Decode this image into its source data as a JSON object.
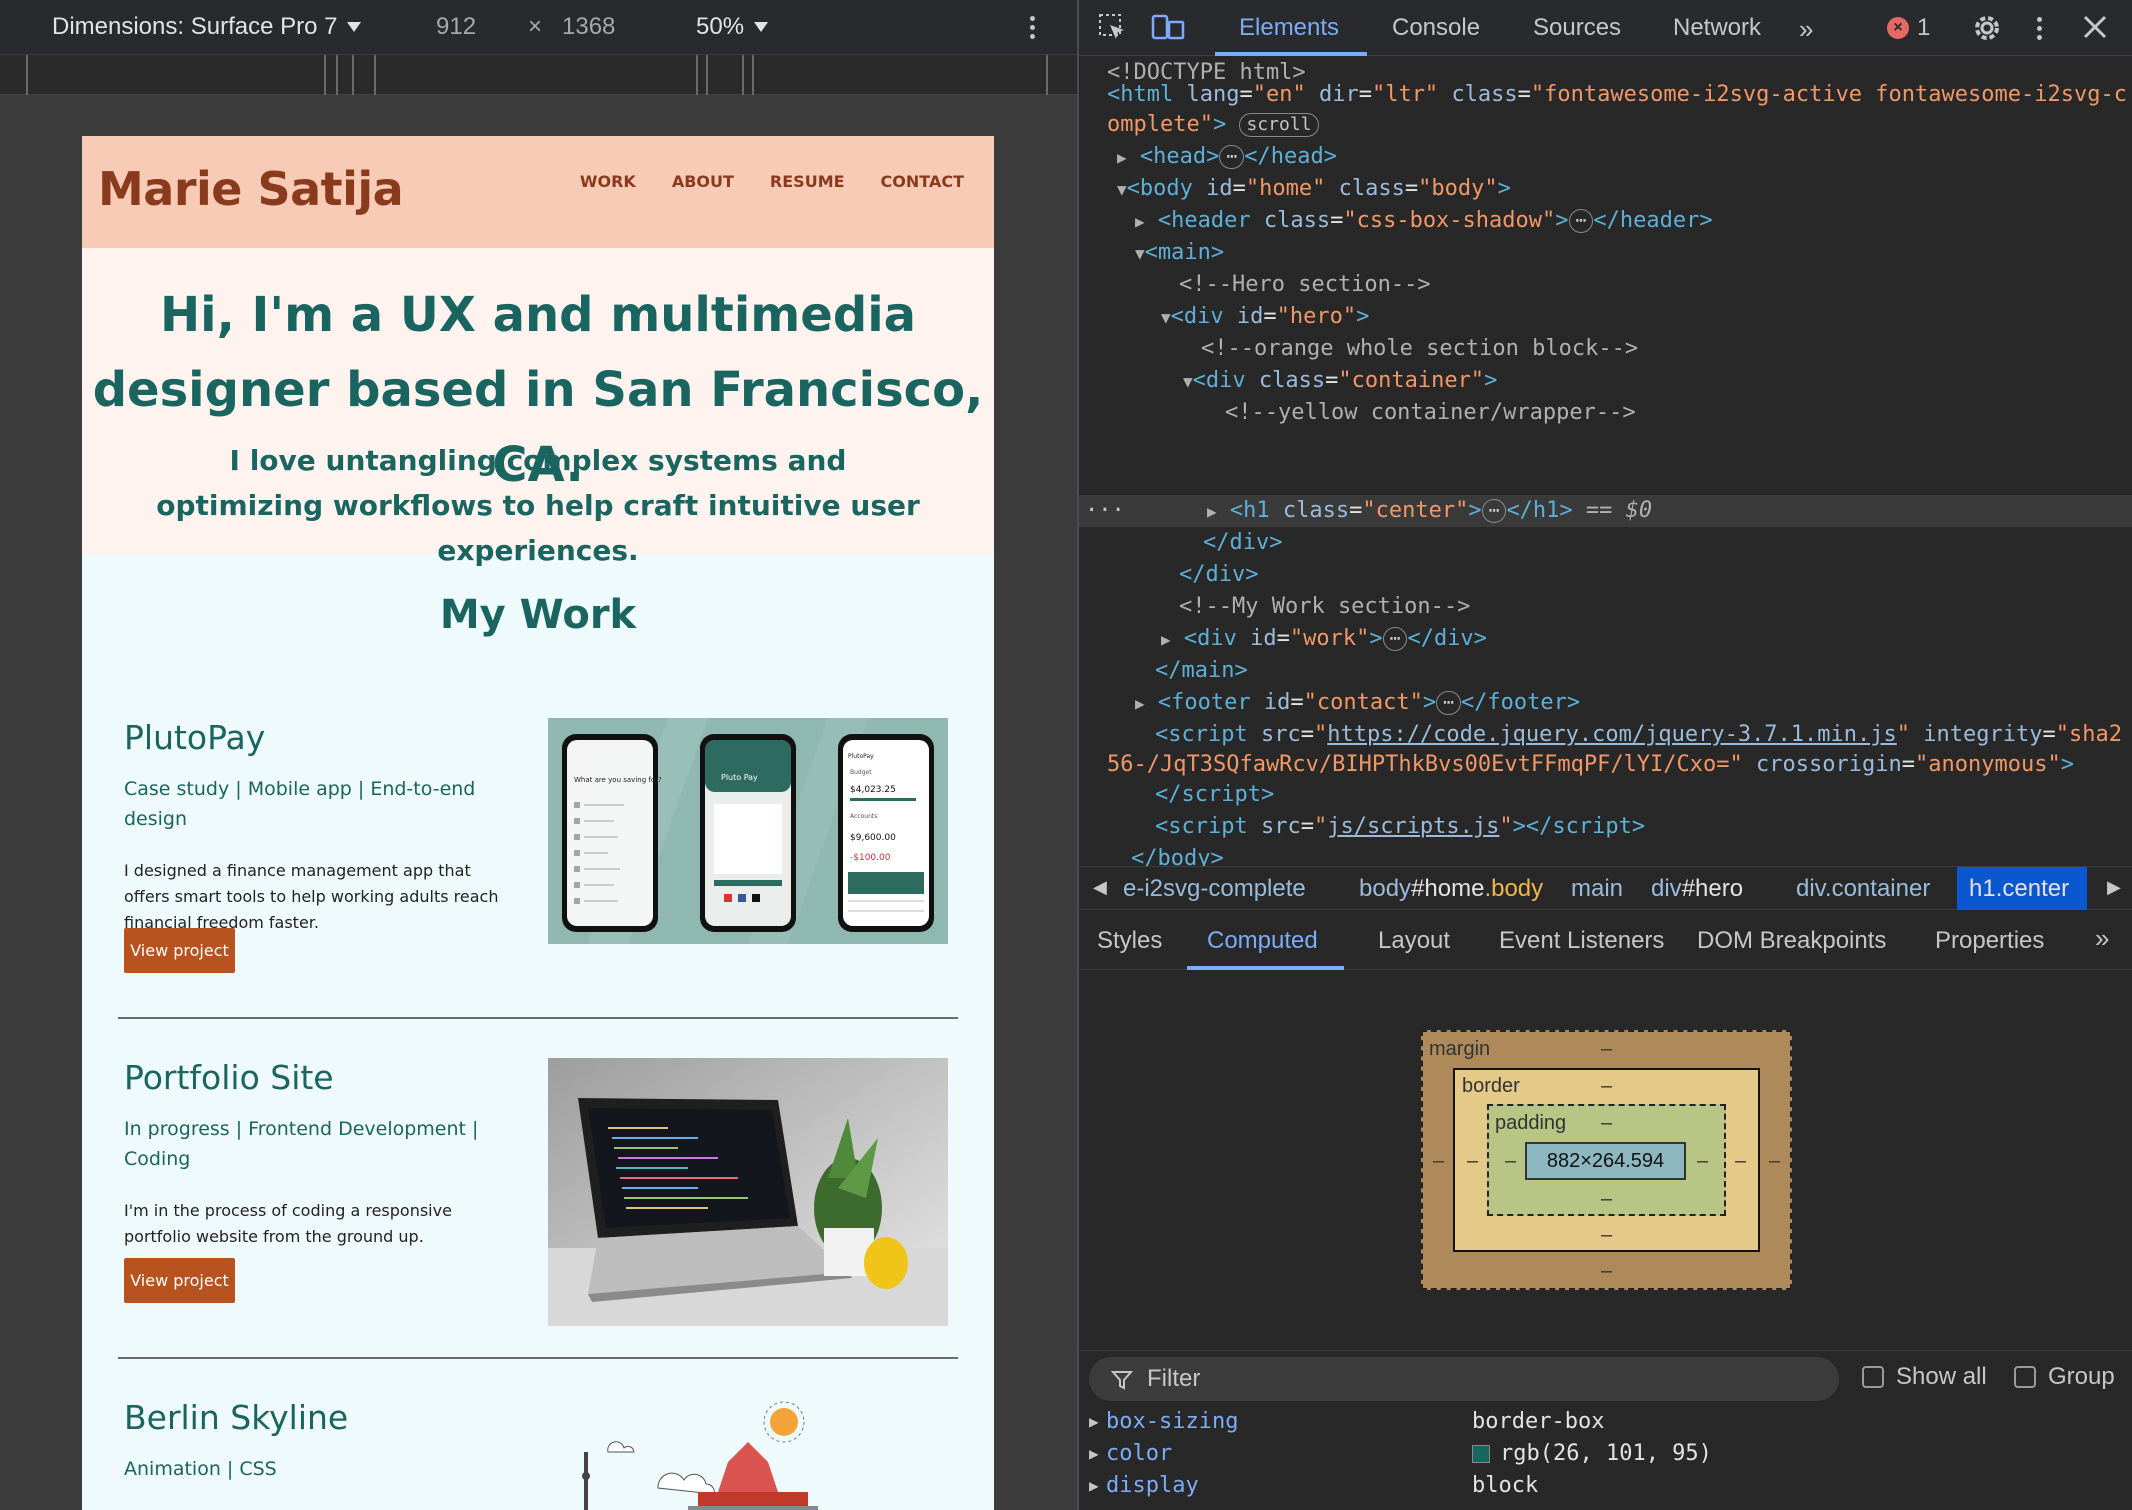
{
  "device_toolbar": {
    "dimensions_label": "Dimensions: Surface Pro 7",
    "width": "912",
    "times": "×",
    "height": "1368",
    "zoom": "50%"
  },
  "site": {
    "logo": "Marie Satija",
    "nav": [
      "WORK",
      "ABOUT",
      "RESUME",
      "CONTACT"
    ],
    "hero_title": "Hi, I'm a UX and multimedia designer based in San Francisco, CA.",
    "hero_subtitle": "I love untangling complex systems and optimizing workflows to help craft intuitive user experiences.",
    "work_heading": "My Work",
    "projects": [
      {
        "title": "PlutoPay",
        "tags": "Case study | Mobile app | End-to-end design",
        "description": "I designed a finance management app that offers smart tools to help working adults reach financial freedom faster.",
        "button": "View project",
        "phone_texts": {
          "p1_heading": "What are you saving for?",
          "p2_brand": "Pluto Pay",
          "p3_brand": "PlutoPay",
          "p3_budget": "Budget",
          "p3_amount1": "$4,023.25",
          "p3_accounts": "Accounts",
          "p3_amount2": "$9,600.00",
          "p3_amount3": "-$100.00"
        }
      },
      {
        "title": "Portfolio Site",
        "tags": "In progress | Frontend Development | Coding",
        "description": "I'm in the process of coding a responsive portfolio website from the ground up.",
        "button": "View project"
      },
      {
        "title": "Berlin Skyline",
        "tags": "Animation | CSS"
      }
    ]
  },
  "devtools": {
    "tabs": [
      "Elements",
      "Console",
      "Sources",
      "Network"
    ],
    "overflow_icon": "chevron-double-right",
    "error_count": "1",
    "dom_lines": {
      "doctype": "<!DOCTYPE html>",
      "html_class_1": "fontawesome-i2svg-active fontawesome-i2svg-c",
      "html_class_2": "omplete",
      "scroll_pill": "scroll",
      "c_hero": "<!--Hero section-->",
      "c_orange": "<!--orange whole section block-->",
      "c_yellow": "<!--yellow container/wrapper-->",
      "c_work": "<!--My Work section-->",
      "dollar0": "== $0",
      "script_src": "https://code.jquery.com/jquery-3.7.1.min.js",
      "integrity_1": "sha2",
      "integrity_2": "56-/JqT3SQfawRcv/BIHPThkBvs00EvtFFmqPF/lYI/Cxo=",
      "crossorigin": "anonymous",
      "script2_src": "js/scripts.js"
    },
    "breadcrumbs": {
      "c1": "e-i2svg-complete",
      "c2_tag": "body",
      "c2_id": "#home",
      "c2_cls": ".body",
      "c3": "main",
      "c4_tag": "div",
      "c4_id": "#hero",
      "c5_tag": "div",
      "c5_cls": ".container",
      "c6_tag": "h1",
      "c6_cls": ".center"
    },
    "sub_tabs": [
      "Styles",
      "Computed",
      "Layout",
      "Event Listeners",
      "DOM Breakpoints",
      "Properties"
    ],
    "box_model": {
      "margin": "margin",
      "border": "border",
      "padding": "padding",
      "dash": "–",
      "content": "882×264.594"
    },
    "filter_placeholder": "Filter",
    "show_all": "Show all",
    "group": "Group",
    "computed": [
      {
        "prop": "box-sizing",
        "value": "border-box"
      },
      {
        "prop": "color",
        "value": "rgb(26, 101, 95)",
        "swatch": "#1a655f"
      },
      {
        "prop": "display",
        "value": "block"
      }
    ]
  }
}
